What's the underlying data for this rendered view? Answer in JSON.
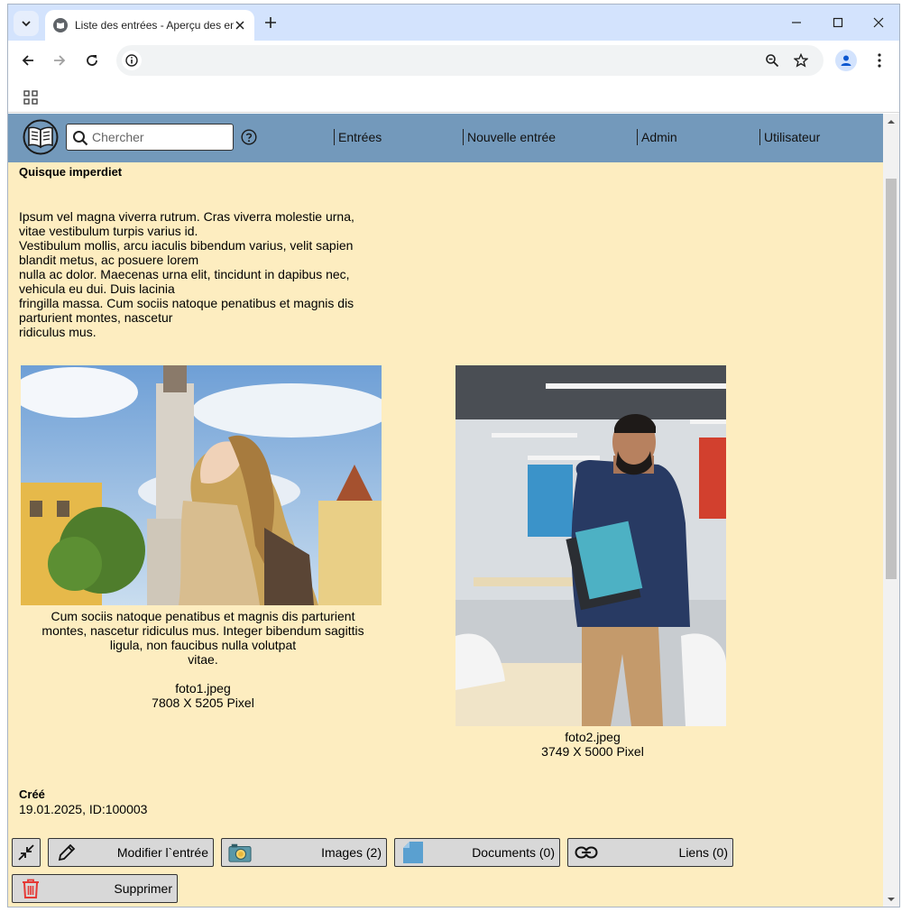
{
  "browser": {
    "tab_title": "Liste des entrées - Aperçu des entrées",
    "url": ""
  },
  "nav": {
    "search_placeholder": "Chercher",
    "links": [
      "Entrées",
      "Nouvelle entrée",
      "Admin",
      "Utilisateur"
    ]
  },
  "entry": {
    "title": "Quisque imperdiet",
    "body_lines": [
      "Ipsum vel magna viverra rutrum. Cras viverra molestie urna,",
      "vitae vestibulum turpis varius id.",
      "Vestibulum mollis, arcu iaculis bibendum varius, velit sapien",
      "blandit metus, ac posuere lorem",
      "nulla ac dolor. Maecenas urna elit, tincidunt in dapibus nec,",
      "vehicula eu dui. Duis lacinia",
      "fringilla massa. Cum sociis natoque penatibus et magnis dis",
      "parturient montes, nascetur",
      "ridiculus mus."
    ]
  },
  "images": [
    {
      "caption_lines": [
        "Cum sociis natoque penatibus et magnis dis parturient",
        "montes, nascetur ridiculus mus. Integer bibendum sagittis",
        "ligula, non faucibus nulla volutpat",
        "vitae."
      ],
      "filename": "foto1.jpeg",
      "dimensions": "7808 X 5205 Pixel"
    },
    {
      "caption_lines": [],
      "filename": "foto2.jpeg",
      "dimensions": "3749 X 5000 Pixel"
    }
  ],
  "meta": {
    "created_label": "Créé",
    "created_value": "19.01.2025, ID:100003"
  },
  "actions": {
    "edit": "Modifier l`entrée",
    "images": "Images (2)",
    "documents": "Documents (0)",
    "links": "Liens (0)",
    "delete": "Supprimer"
  },
  "colors": {
    "page_bg": "#fdedc0",
    "navbar_bg": "#7399bb",
    "button_bg": "#d8d8d8",
    "delete_icon": "#e53935"
  }
}
